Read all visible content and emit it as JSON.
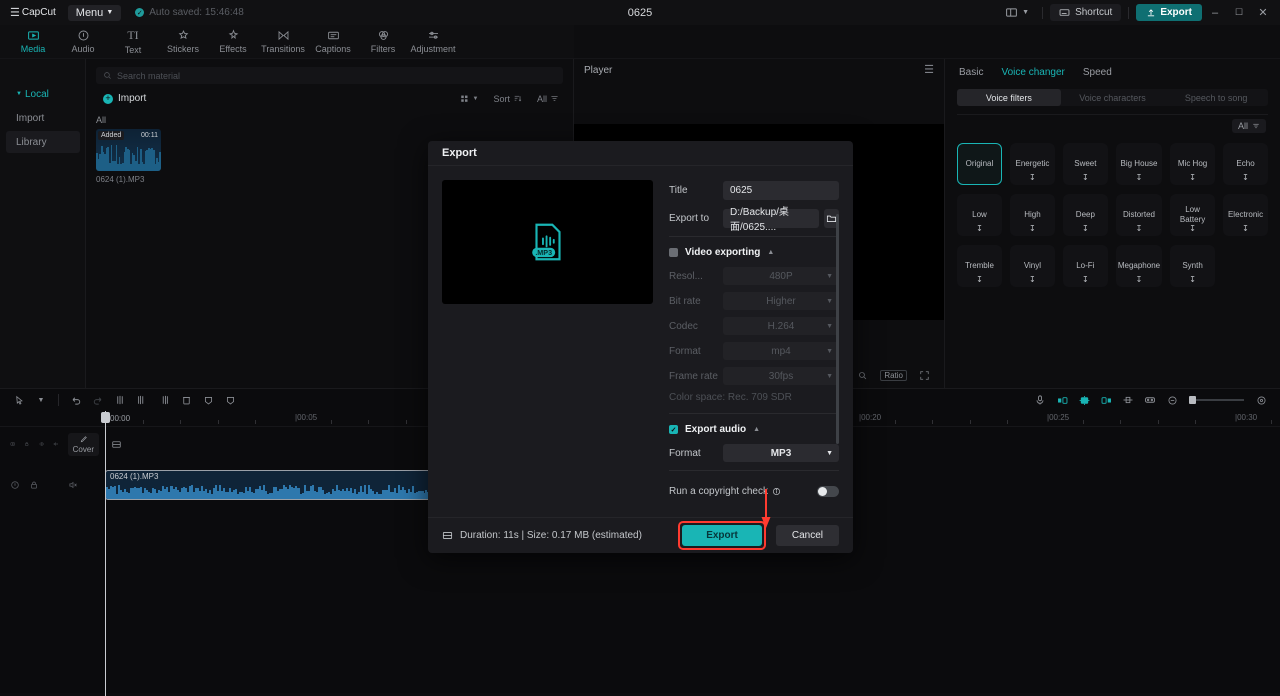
{
  "titlebar": {
    "brand": "CapCut",
    "menu_label": "Menu",
    "autosave": "Auto saved: 15:46:48",
    "project_title": "0625",
    "layout_icon": "layout-icon",
    "shortcut_label": "Shortcut",
    "export_label": "Export",
    "minimize": "–",
    "maximize": "❐",
    "close": "✕"
  },
  "topnav": {
    "items": [
      {
        "label": "Media",
        "icon": "media-icon",
        "active": true
      },
      {
        "label": "Audio",
        "icon": "audio-icon",
        "active": false
      },
      {
        "label": "Text",
        "icon": "text-icon",
        "active": false
      },
      {
        "label": "Stickers",
        "icon": "stickers-icon",
        "active": false
      },
      {
        "label": "Effects",
        "icon": "effects-icon",
        "active": false
      },
      {
        "label": "Transitions",
        "icon": "transitions-icon",
        "active": false
      },
      {
        "label": "Captions",
        "icon": "captions-icon",
        "active": false
      },
      {
        "label": "Filters",
        "icon": "filters-icon",
        "active": false
      },
      {
        "label": "Adjustment",
        "icon": "adjustment-icon",
        "active": false
      }
    ]
  },
  "sidebar": {
    "items": [
      {
        "label": "Local",
        "active": true
      },
      {
        "label": "Import",
        "active": false
      },
      {
        "label": "Library",
        "active": false
      }
    ]
  },
  "media": {
    "search_placeholder": "Search material",
    "import_label": "Import",
    "view_mode": "grid-view",
    "sort_label": "Sort",
    "filter_label": "All",
    "group_label": "All",
    "items": [
      {
        "badge": "Added",
        "duration": "00:11",
        "name": "0624 (1).MP3"
      }
    ]
  },
  "player": {
    "title": "Player",
    "menu_icon": "hamburger-icon",
    "zoom_icon": "magnifier-icon",
    "ratio_label": "Ratio",
    "fullscreen_icon": "fullscreen-icon"
  },
  "right_panel": {
    "tabs": [
      {
        "label": "Basic",
        "active": false
      },
      {
        "label": "Voice changer",
        "active": true
      },
      {
        "label": "Speed",
        "active": false
      }
    ],
    "segments": [
      {
        "label": "Voice filters",
        "active": true
      },
      {
        "label": "Voice characters",
        "active": false
      },
      {
        "label": "Speech to song",
        "active": false
      }
    ],
    "filter_all_label": "All",
    "voice_filters": [
      {
        "label": "Original",
        "selected": true,
        "downloadable": false
      },
      {
        "label": "Energetic",
        "selected": false,
        "downloadable": true
      },
      {
        "label": "Sweet",
        "selected": false,
        "downloadable": true
      },
      {
        "label": "Big House",
        "selected": false,
        "downloadable": true
      },
      {
        "label": "Mic Hog",
        "selected": false,
        "downloadable": true
      },
      {
        "label": "Echo",
        "selected": false,
        "downloadable": true
      },
      {
        "label": "Low",
        "selected": false,
        "downloadable": true
      },
      {
        "label": "High",
        "selected": false,
        "downloadable": true
      },
      {
        "label": "Deep",
        "selected": false,
        "downloadable": true
      },
      {
        "label": "Distorted",
        "selected": false,
        "downloadable": true
      },
      {
        "label": "Low Battery",
        "selected": false,
        "downloadable": true
      },
      {
        "label": "Electronic",
        "selected": false,
        "downloadable": true
      },
      {
        "label": "Tremble",
        "selected": false,
        "downloadable": true
      },
      {
        "label": "Vinyl",
        "selected": false,
        "downloadable": true
      },
      {
        "label": "Lo-Fi",
        "selected": false,
        "downloadable": true
      },
      {
        "label": "Megaphone",
        "selected": false,
        "downloadable": true
      },
      {
        "label": "Synth",
        "selected": false,
        "downloadable": true
      }
    ]
  },
  "timeline": {
    "tools": [
      {
        "icon": "select-arrow-icon"
      },
      {
        "icon": "chevron-down-icon"
      },
      {
        "icon": "undo-icon"
      },
      {
        "icon": "redo-icon"
      },
      {
        "icon": "split-icon"
      },
      {
        "icon": "trim-left-icon"
      },
      {
        "icon": "trim-right-icon"
      },
      {
        "icon": "delete-icon"
      },
      {
        "icon": "freeze-icon"
      },
      {
        "icon": "mask-icon"
      }
    ],
    "right_tools": [
      {
        "icon": "mic-record-icon"
      },
      {
        "icon": "keyframe-prev-icon"
      },
      {
        "icon": "keyframe-add-icon"
      },
      {
        "icon": "keyframe-next-icon"
      },
      {
        "icon": "mirror-icon"
      },
      {
        "icon": "preview-icon"
      },
      {
        "icon": "zoom-out-icon"
      },
      {
        "icon": "zoom-fit-icon"
      }
    ],
    "current_time": "00:00",
    "ruler_labels": [
      "00:00",
      "00:05",
      "00:20",
      "00:25",
      "00:30"
    ],
    "cover_label": "Cover",
    "video_track_icons": [
      "monitor-icon",
      "lock-icon",
      "eye-icon",
      "mute-icon"
    ],
    "audio_track_icons": [
      "music-note-icon",
      "lock-icon",
      "mute-icon"
    ],
    "main_track_icon": "main-track-icon",
    "clip": {
      "name": "0624 (1).MP3"
    }
  },
  "export_dialog": {
    "title": "Export",
    "preview_icon": "mp3-file-icon",
    "preview_badge": ".MP3",
    "title_label": "Title",
    "title_value": "0625",
    "export_to_label": "Export to",
    "export_to_value": "D:/Backup/桌面/0625....",
    "folder_icon": "folder-icon",
    "video_section": {
      "label": "Video exporting",
      "checked": false,
      "rows": [
        {
          "label": "Resol...",
          "value": "480P"
        },
        {
          "label": "Bit rate",
          "value": "Higher"
        },
        {
          "label": "Codec",
          "value": "H.264"
        },
        {
          "label": "Format",
          "value": "mp4"
        },
        {
          "label": "Frame rate",
          "value": "30fps"
        }
      ],
      "color_space": "Color space: Rec. 709 SDR"
    },
    "audio_section": {
      "label": "Export audio",
      "checked": true,
      "rows": [
        {
          "label": "Format",
          "value": "MP3"
        }
      ]
    },
    "copyright": {
      "label": "Run a copyright check",
      "info_icon": "info-icon",
      "enabled": false
    },
    "footer": {
      "info_icon": "film-icon",
      "info": "Duration: 11s | Size: 0.17 MB (estimated)",
      "export_label": "Export",
      "cancel_label": "Cancel"
    }
  },
  "colors": {
    "accent": "#19b5b5",
    "highlight": "#ff3b30",
    "panel": "#0d0d0f",
    "dialog": "#1b1b1f"
  }
}
